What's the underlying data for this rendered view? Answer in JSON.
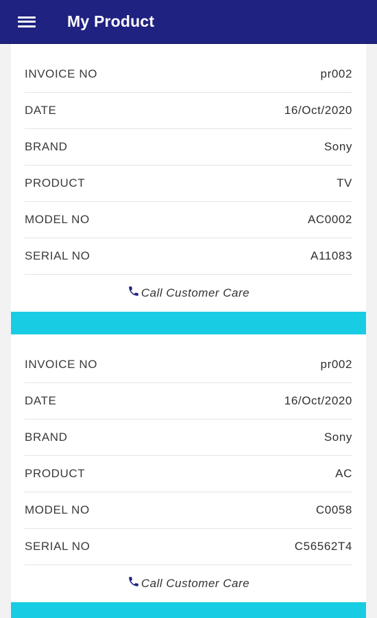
{
  "appbar": {
    "title": "My Product",
    "color": "#1f2280",
    "menu_icon": "hamburger-menu-icon"
  },
  "field_labels": {
    "invoice": "INVOICE NO",
    "date": "DATE",
    "brand": "BRAND",
    "product": "PRODUCT",
    "model": "MODEL NO",
    "serial": "SERIAL NO"
  },
  "products": [
    {
      "invoice": "pr002",
      "date": "16/Oct/2020",
      "brand": "Sony",
      "product": "TV",
      "model": "AC0002",
      "serial": "A11083",
      "care_label": "Call Customer Care"
    },
    {
      "invoice": "pr002",
      "date": "16/Oct/2020",
      "brand": "Sony",
      "product": "AC",
      "model": "C0058",
      "serial": "C56562T4",
      "care_label": "Call Customer Care"
    }
  ],
  "colors": {
    "accent_divider": "#18cce3",
    "phone_icon": "#1f2280"
  },
  "care_icon": "phone-icon"
}
